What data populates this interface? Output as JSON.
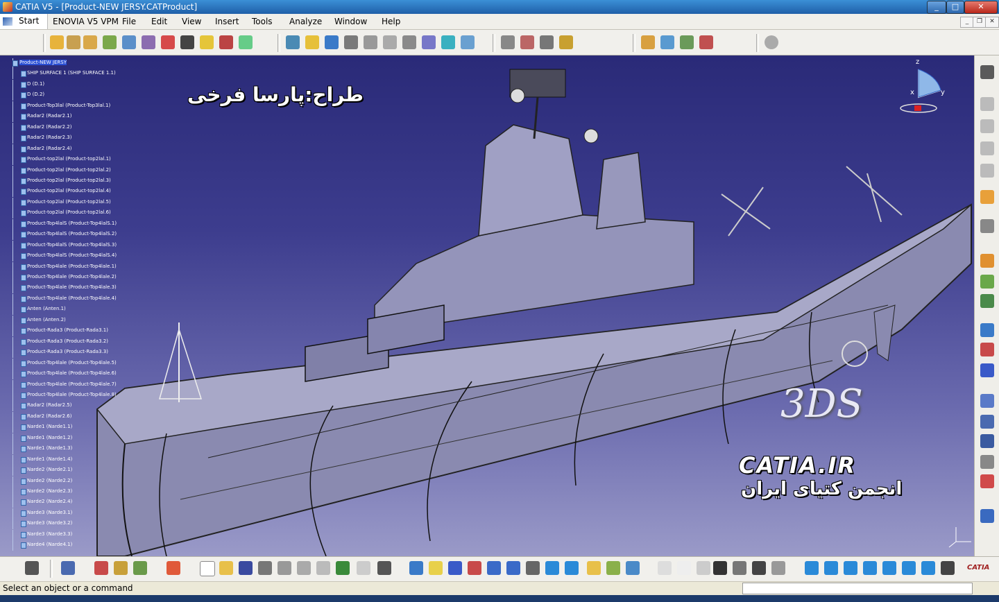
{
  "window": {
    "title": "CATIA V5 - [Product-NEW JERSY.CATProduct]",
    "buttons": {
      "minimize": "_",
      "maximize": "□",
      "close": "✕"
    }
  },
  "menu": {
    "start": "Start",
    "items": [
      "ENOVIA V5 VPM",
      "File",
      "Edit",
      "View",
      "Insert",
      "Tools",
      "Analyze",
      "Window",
      "Help"
    ]
  },
  "tree": {
    "root": "Product-NEW JERSY",
    "nodes": [
      "SHIP SURFACE 1 (SHIP SURFACE 1.1)",
      "D (D.1)",
      "D (D.2)",
      "Product-Top3lal (Product-Top3lal.1)",
      "Radar2 (Radar2.1)",
      "Radar2 (Radar2.2)",
      "Radar2 (Radar2.3)",
      "Radar2 (Radar2.4)",
      "Product-top2lal (Product-top2lal.1)",
      "Product-top2lal (Product-top2lal.2)",
      "Product-top2lal (Product-top2lal.3)",
      "Product-top2lal (Product-top2lal.4)",
      "Product-top2lal (Product-top2lal.5)",
      "Product-top2lal (Product-top2lal.6)",
      "Product-Top4lalS (Product-Top4lalS.1)",
      "Product-Top4lalS (Product-Top4lalS.2)",
      "Product-Top4lalS (Product-Top4lalS.3)",
      "Product-Top4lalS (Product-Top4lalS.4)",
      "Product-Top4lale (Product-Top4lale.1)",
      "Product-Top4lale (Product-Top4lale.2)",
      "Product-Top4lale (Product-Top4lale.3)",
      "Product-Top4lale (Product-Top4lale.4)",
      "Anten (Anten.1)",
      "Anten (Anten.2)",
      "Product-Rada3 (Product-Rada3.1)",
      "Product-Rada3 (Product-Rada3.2)",
      "Product-Rada3 (Product-Rada3.3)",
      "Product-Top4lale (Product-Top4lale.5)",
      "Product-Top4lale (Product-Top4lale.6)",
      "Product-Top4lale (Product-Top4lale.7)",
      "Product-Top4lale (Product-Top4lale.8)",
      "Radar2 (Radar2.5)",
      "Radar2 (Radar2.6)",
      "Narde1 (Narde1.1)",
      "Narde1 (Narde1.2)",
      "Narde1 (Narde1.3)",
      "Narde1 (Narde1.4)",
      "Narde2 (Narde2.1)",
      "Narde2 (Narde2.2)",
      "Narde2 (Narde2.3)",
      "Narde2 (Narde2.4)",
      "Narde3 (Narde3.1)",
      "Narde3 (Narde3.2)",
      "Narde3 (Narde3.3)",
      "Narde4 (Narde4.1)"
    ]
  },
  "overlay": {
    "designer": "طراح:پارسا فرخی",
    "site": "CATIA.IR",
    "forum": "انجمن کتیای ایران",
    "logo_text": "3DS"
  },
  "compass": {
    "x": "x",
    "y": "y",
    "z": "z"
  },
  "status": {
    "message": "Select an object or a command"
  },
  "brand": {
    "corner_logo": "CATIA",
    "accent": "#2a4fd4",
    "viewport_top": "#2a2a78",
    "viewport_bottom": "#9a9ac8"
  }
}
